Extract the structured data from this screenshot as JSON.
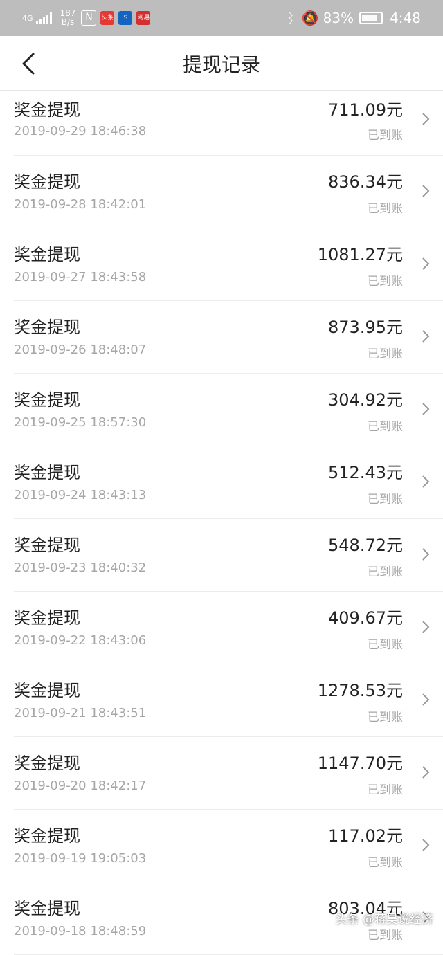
{
  "status_bar": {
    "signal_label": "4G",
    "net_speed_value": "187",
    "net_speed_unit": "B/s",
    "app_icons": [
      "头条",
      "S",
      "网易"
    ],
    "battery": "83%",
    "time": "4:48",
    "icons": [
      "nfc-icon",
      "bluetooth-icon",
      "mute-bell-icon",
      "battery-icon"
    ]
  },
  "header": {
    "title": "提现记录",
    "back_icon": "chevron-left-icon"
  },
  "records": [
    {
      "title": "奖金提现",
      "time": "2019-09-29 18:46:38",
      "amount": "711.09元",
      "status": "已到账"
    },
    {
      "title": "奖金提现",
      "time": "2019-09-28 18:42:01",
      "amount": "836.34元",
      "status": "已到账"
    },
    {
      "title": "奖金提现",
      "time": "2019-09-27 18:43:58",
      "amount": "1081.27元",
      "status": "已到账"
    },
    {
      "title": "奖金提现",
      "time": "2019-09-26 18:48:07",
      "amount": "873.95元",
      "status": "已到账"
    },
    {
      "title": "奖金提现",
      "time": "2019-09-25 18:57:30",
      "amount": "304.92元",
      "status": "已到账"
    },
    {
      "title": "奖金提现",
      "time": "2019-09-24 18:43:13",
      "amount": "512.43元",
      "status": "已到账"
    },
    {
      "title": "奖金提现",
      "time": "2019-09-23 18:40:32",
      "amount": "548.72元",
      "status": "已到账"
    },
    {
      "title": "奖金提现",
      "time": "2019-09-22 18:43:06",
      "amount": "409.67元",
      "status": "已到账"
    },
    {
      "title": "奖金提现",
      "time": "2019-09-21 18:43:51",
      "amount": "1278.53元",
      "status": "已到账"
    },
    {
      "title": "奖金提现",
      "time": "2019-09-20 18:42:17",
      "amount": "1147.70元",
      "status": "已到账"
    },
    {
      "title": "奖金提现",
      "time": "2019-09-19 19:05:03",
      "amount": "117.02元",
      "status": "已到账"
    },
    {
      "title": "奖金提现",
      "time": "2019-09-18 18:48:59",
      "amount": "803.04元",
      "status": "已到账"
    }
  ],
  "watermark": "头条 @蒋昊说经济",
  "colors": {
    "status_bar_bg": "#bdbdbd",
    "secondary_text": "#a6a6a6",
    "divider": "#ececec"
  }
}
